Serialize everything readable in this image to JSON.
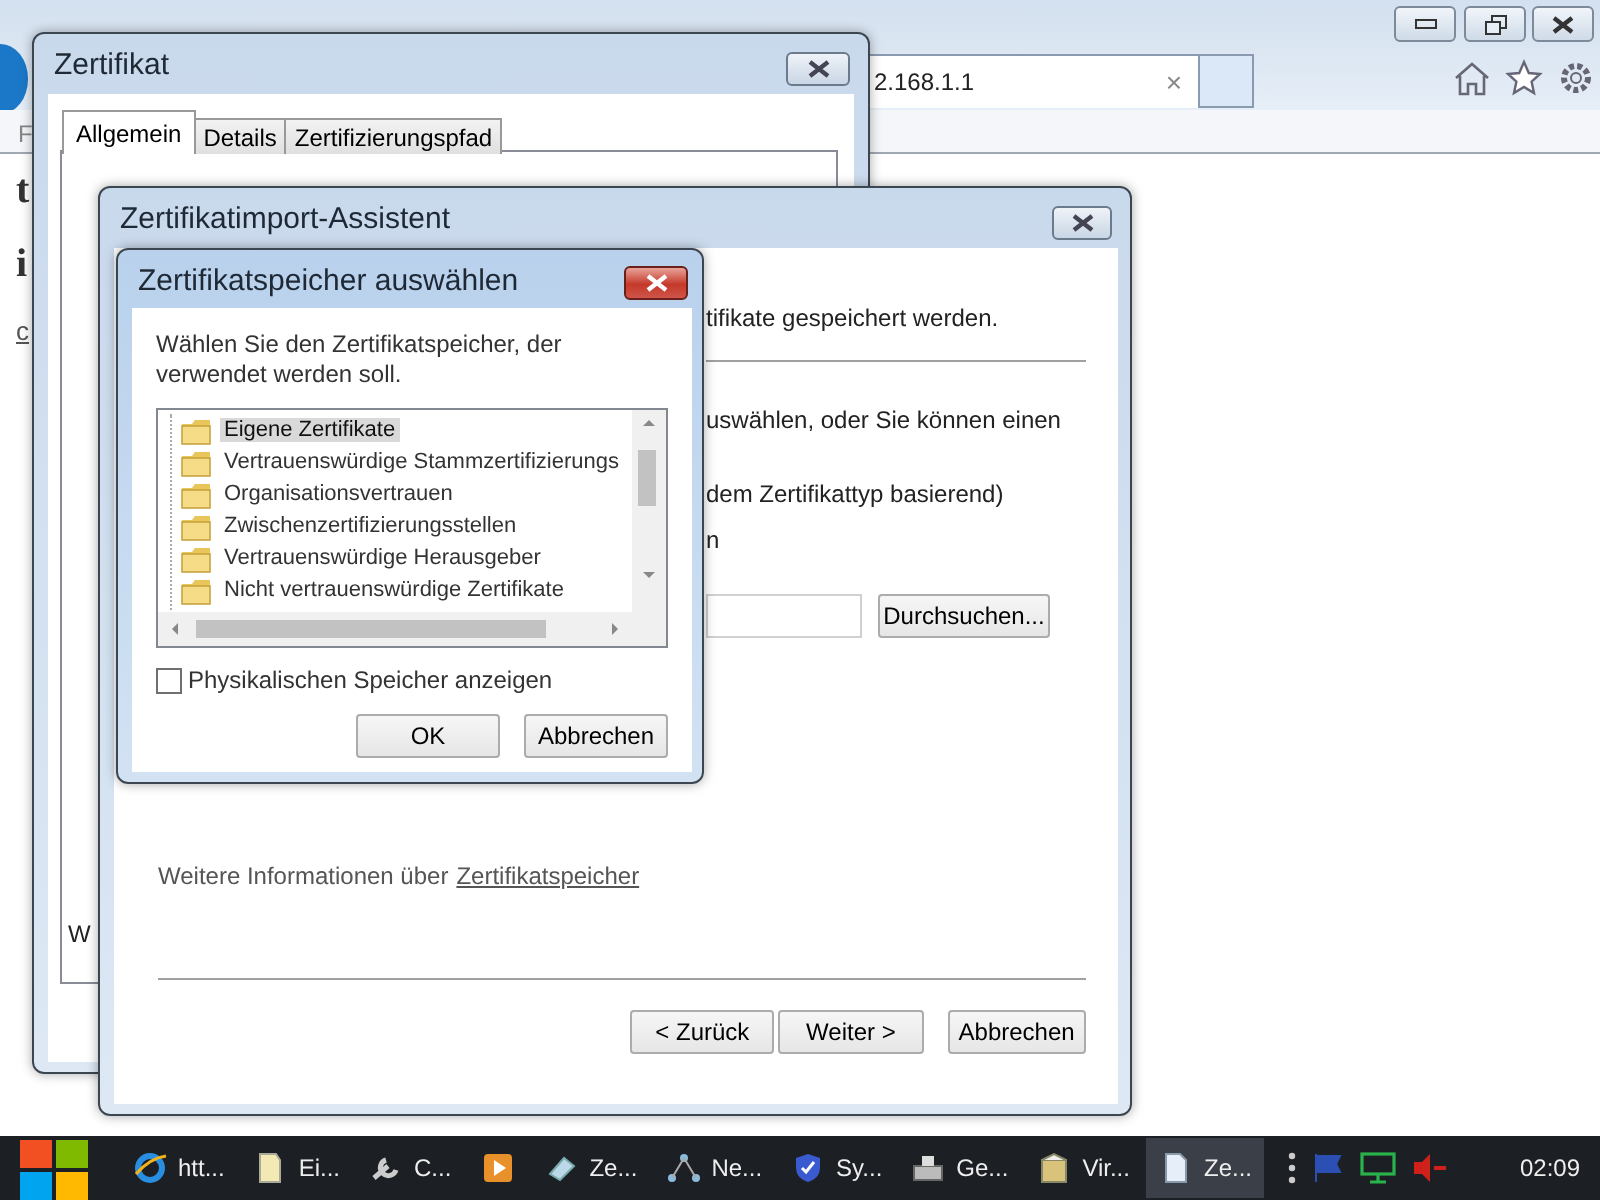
{
  "browser": {
    "menu_letter": "F",
    "address": "2.168.1.1",
    "tab_close": "×",
    "page_texts": [
      {
        "text": "t",
        "kind": "heading"
      },
      {
        "text": "i",
        "kind": "heading"
      },
      {
        "text": "c",
        "kind": "link"
      }
    ]
  },
  "certificate_window": {
    "title": "Zertifikat",
    "tabs": [
      {
        "label": "Allgemein",
        "selected": true
      },
      {
        "label": "Details",
        "selected": false
      },
      {
        "label": "Zertifizierungspfad",
        "selected": false
      }
    ],
    "panel_text": "W"
  },
  "import_wizard": {
    "title": "Zertifikatimport-Assistent",
    "lines": [
      "tifikate gespeichert werden.",
      "uswählen, oder Sie können einen",
      "dem Zertifikattyp basierend)",
      "n"
    ],
    "browse_button": "Durchsuchen...",
    "info_text": "Weitere Informationen über",
    "info_link": "Zertifikatspeicher",
    "buttons": [
      "< Zurück",
      "Weiter >",
      "Abbrechen"
    ]
  },
  "store_dialog": {
    "title": "Zertifikatspeicher auswählen",
    "description": "Wählen Sie den Zertifikatspeicher, der verwendet werden soll.",
    "stores": [
      {
        "label": "Eigene Zertifikate",
        "selected": true
      },
      {
        "label": "Vertrauenswürdige Stammzertifizierungs",
        "selected": false
      },
      {
        "label": "Organisationsvertrauen",
        "selected": false
      },
      {
        "label": "Zwischenzertifizierungsstellen",
        "selected": false
      },
      {
        "label": "Vertrauenswürdige Herausgeber",
        "selected": false
      },
      {
        "label": "Nicht vertrauenswürdige Zertifikate",
        "selected": false
      }
    ],
    "checkbox": {
      "label": "Physikalischen Speicher anzeigen",
      "checked": false
    },
    "buttons": [
      "OK",
      "Abbrechen"
    ]
  },
  "taskbar": {
    "items": [
      {
        "kind": "browser",
        "label": "htt...",
        "active": false
      },
      {
        "kind": "file",
        "label": "Ei...",
        "active": false
      },
      {
        "kind": "tool",
        "label": "C...",
        "active": false
      },
      {
        "kind": "media",
        "active": false
      },
      {
        "kind": "eraser",
        "label": "Ze...",
        "active": false
      },
      {
        "kind": "network",
        "label": "Ne...",
        "active": false
      },
      {
        "kind": "shield",
        "label": "Sy...",
        "active": false
      },
      {
        "kind": "device",
        "label": "Ge...",
        "active": false
      },
      {
        "kind": "box",
        "label": "Vir...",
        "active": false
      },
      {
        "kind": "document",
        "label": "Ze...",
        "active": true
      }
    ],
    "clock": "02:09"
  }
}
